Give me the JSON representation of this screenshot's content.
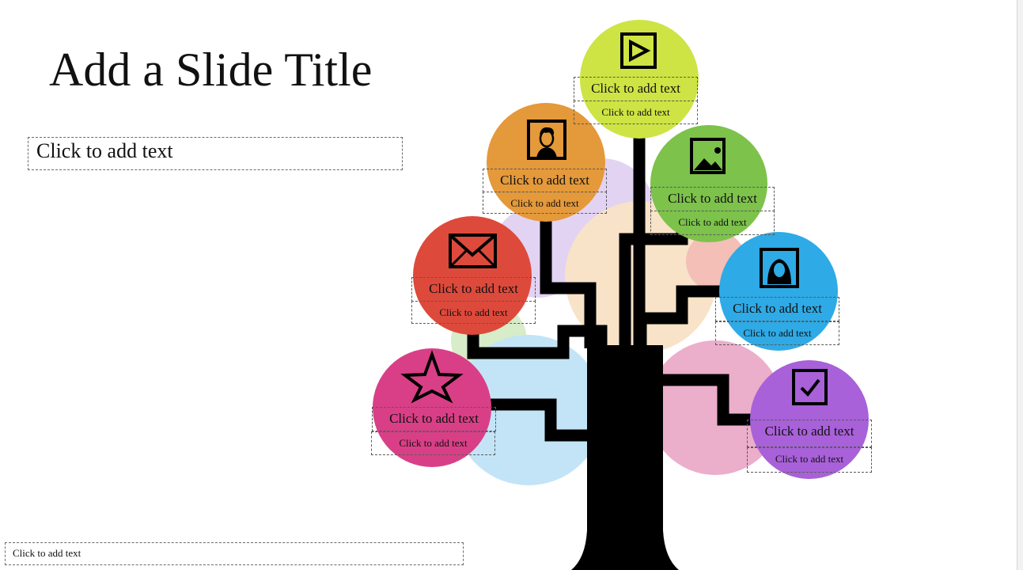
{
  "slide": {
    "title": "Add a Slide Title",
    "body_placeholder": "Click to add text",
    "footer_placeholder": "Click to add text"
  },
  "nodes": [
    {
      "name": "node-video",
      "icon": "play-icon",
      "color": "#cde444",
      "label": "Click to add text",
      "sublabel": "Click to add text"
    },
    {
      "name": "node-man",
      "icon": "man-portrait-icon",
      "color": "#e4993a",
      "label": "Click to add text",
      "sublabel": "Click to add text"
    },
    {
      "name": "node-picture",
      "icon": "picture-icon",
      "color": "#7dc24b",
      "label": "Click to add text",
      "sublabel": "Click to add text"
    },
    {
      "name": "node-mail",
      "icon": "mail-icon",
      "color": "#dd4a3c",
      "label": "Click to add text",
      "sublabel": "Click to add text"
    },
    {
      "name": "node-woman",
      "icon": "woman-portrait-icon",
      "color": "#2eaae6",
      "label": "Click to add text",
      "sublabel": "Click to add text"
    },
    {
      "name": "node-star",
      "icon": "star-icon",
      "color": "#d93f86",
      "label": "Click to add text",
      "sublabel": "Click to add text"
    },
    {
      "name": "node-check",
      "icon": "checkbox-icon",
      "color": "#a861d8",
      "label": "Click to add text",
      "sublabel": "Click to add text"
    }
  ],
  "background_bubble_colors": [
    "#e3d3f3",
    "#f8e3c8",
    "#c3e4f7",
    "#ebaecb",
    "#d7ecc8",
    "#f3bfb6"
  ]
}
